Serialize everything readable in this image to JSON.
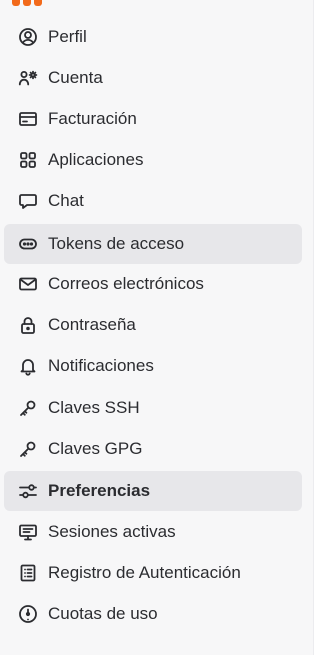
{
  "sidebar": {
    "items": [
      {
        "label": "Perfil",
        "icon": "user-circle-icon"
      },
      {
        "label": "Cuenta",
        "icon": "user-gear-icon"
      },
      {
        "label": "Facturación",
        "icon": "credit-card-icon"
      },
      {
        "label": "Aplicaciones",
        "icon": "apps-grid-icon"
      },
      {
        "label": "Chat",
        "icon": "chat-bubble-icon"
      },
      {
        "label": "Tokens de acceso",
        "icon": "token-icon",
        "state": "hover"
      },
      {
        "label": "Correos electrónicos",
        "icon": "mail-icon"
      },
      {
        "label": "Contraseña",
        "icon": "lock-icon"
      },
      {
        "label": "Notificaciones",
        "icon": "bell-icon"
      },
      {
        "label": "Claves SSH",
        "icon": "key-icon"
      },
      {
        "label": "Claves GPG",
        "icon": "key-icon"
      },
      {
        "label": "Preferencias",
        "icon": "sliders-icon",
        "state": "selected"
      },
      {
        "label": "Sesiones activas",
        "icon": "monitor-icon"
      },
      {
        "label": "Registro de Autenticación",
        "icon": "log-list-icon"
      },
      {
        "label": "Cuotas de uso",
        "icon": "gauge-icon"
      }
    ]
  },
  "colors": {
    "text": "#2b2c30",
    "sidebar_bg": "#f7f7f8",
    "active_bg": "#e7e7ea",
    "logo": "#f26a1b"
  }
}
